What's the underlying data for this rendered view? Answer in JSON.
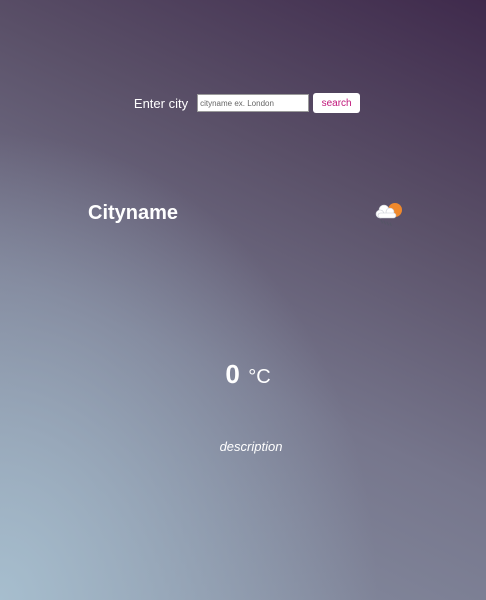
{
  "search": {
    "label": "Enter city",
    "placeholder": "cityname ex. London",
    "value": "",
    "button_label": "search"
  },
  "weather": {
    "city": "Cityname",
    "temperature": "0",
    "unit": "°C",
    "description": "description",
    "icon": "cloud-sun-rain-icon"
  },
  "colors": {
    "button_text": "#c0157a",
    "sun": "#f0892c",
    "cloud": "#ffffff",
    "rain": "#555566"
  }
}
